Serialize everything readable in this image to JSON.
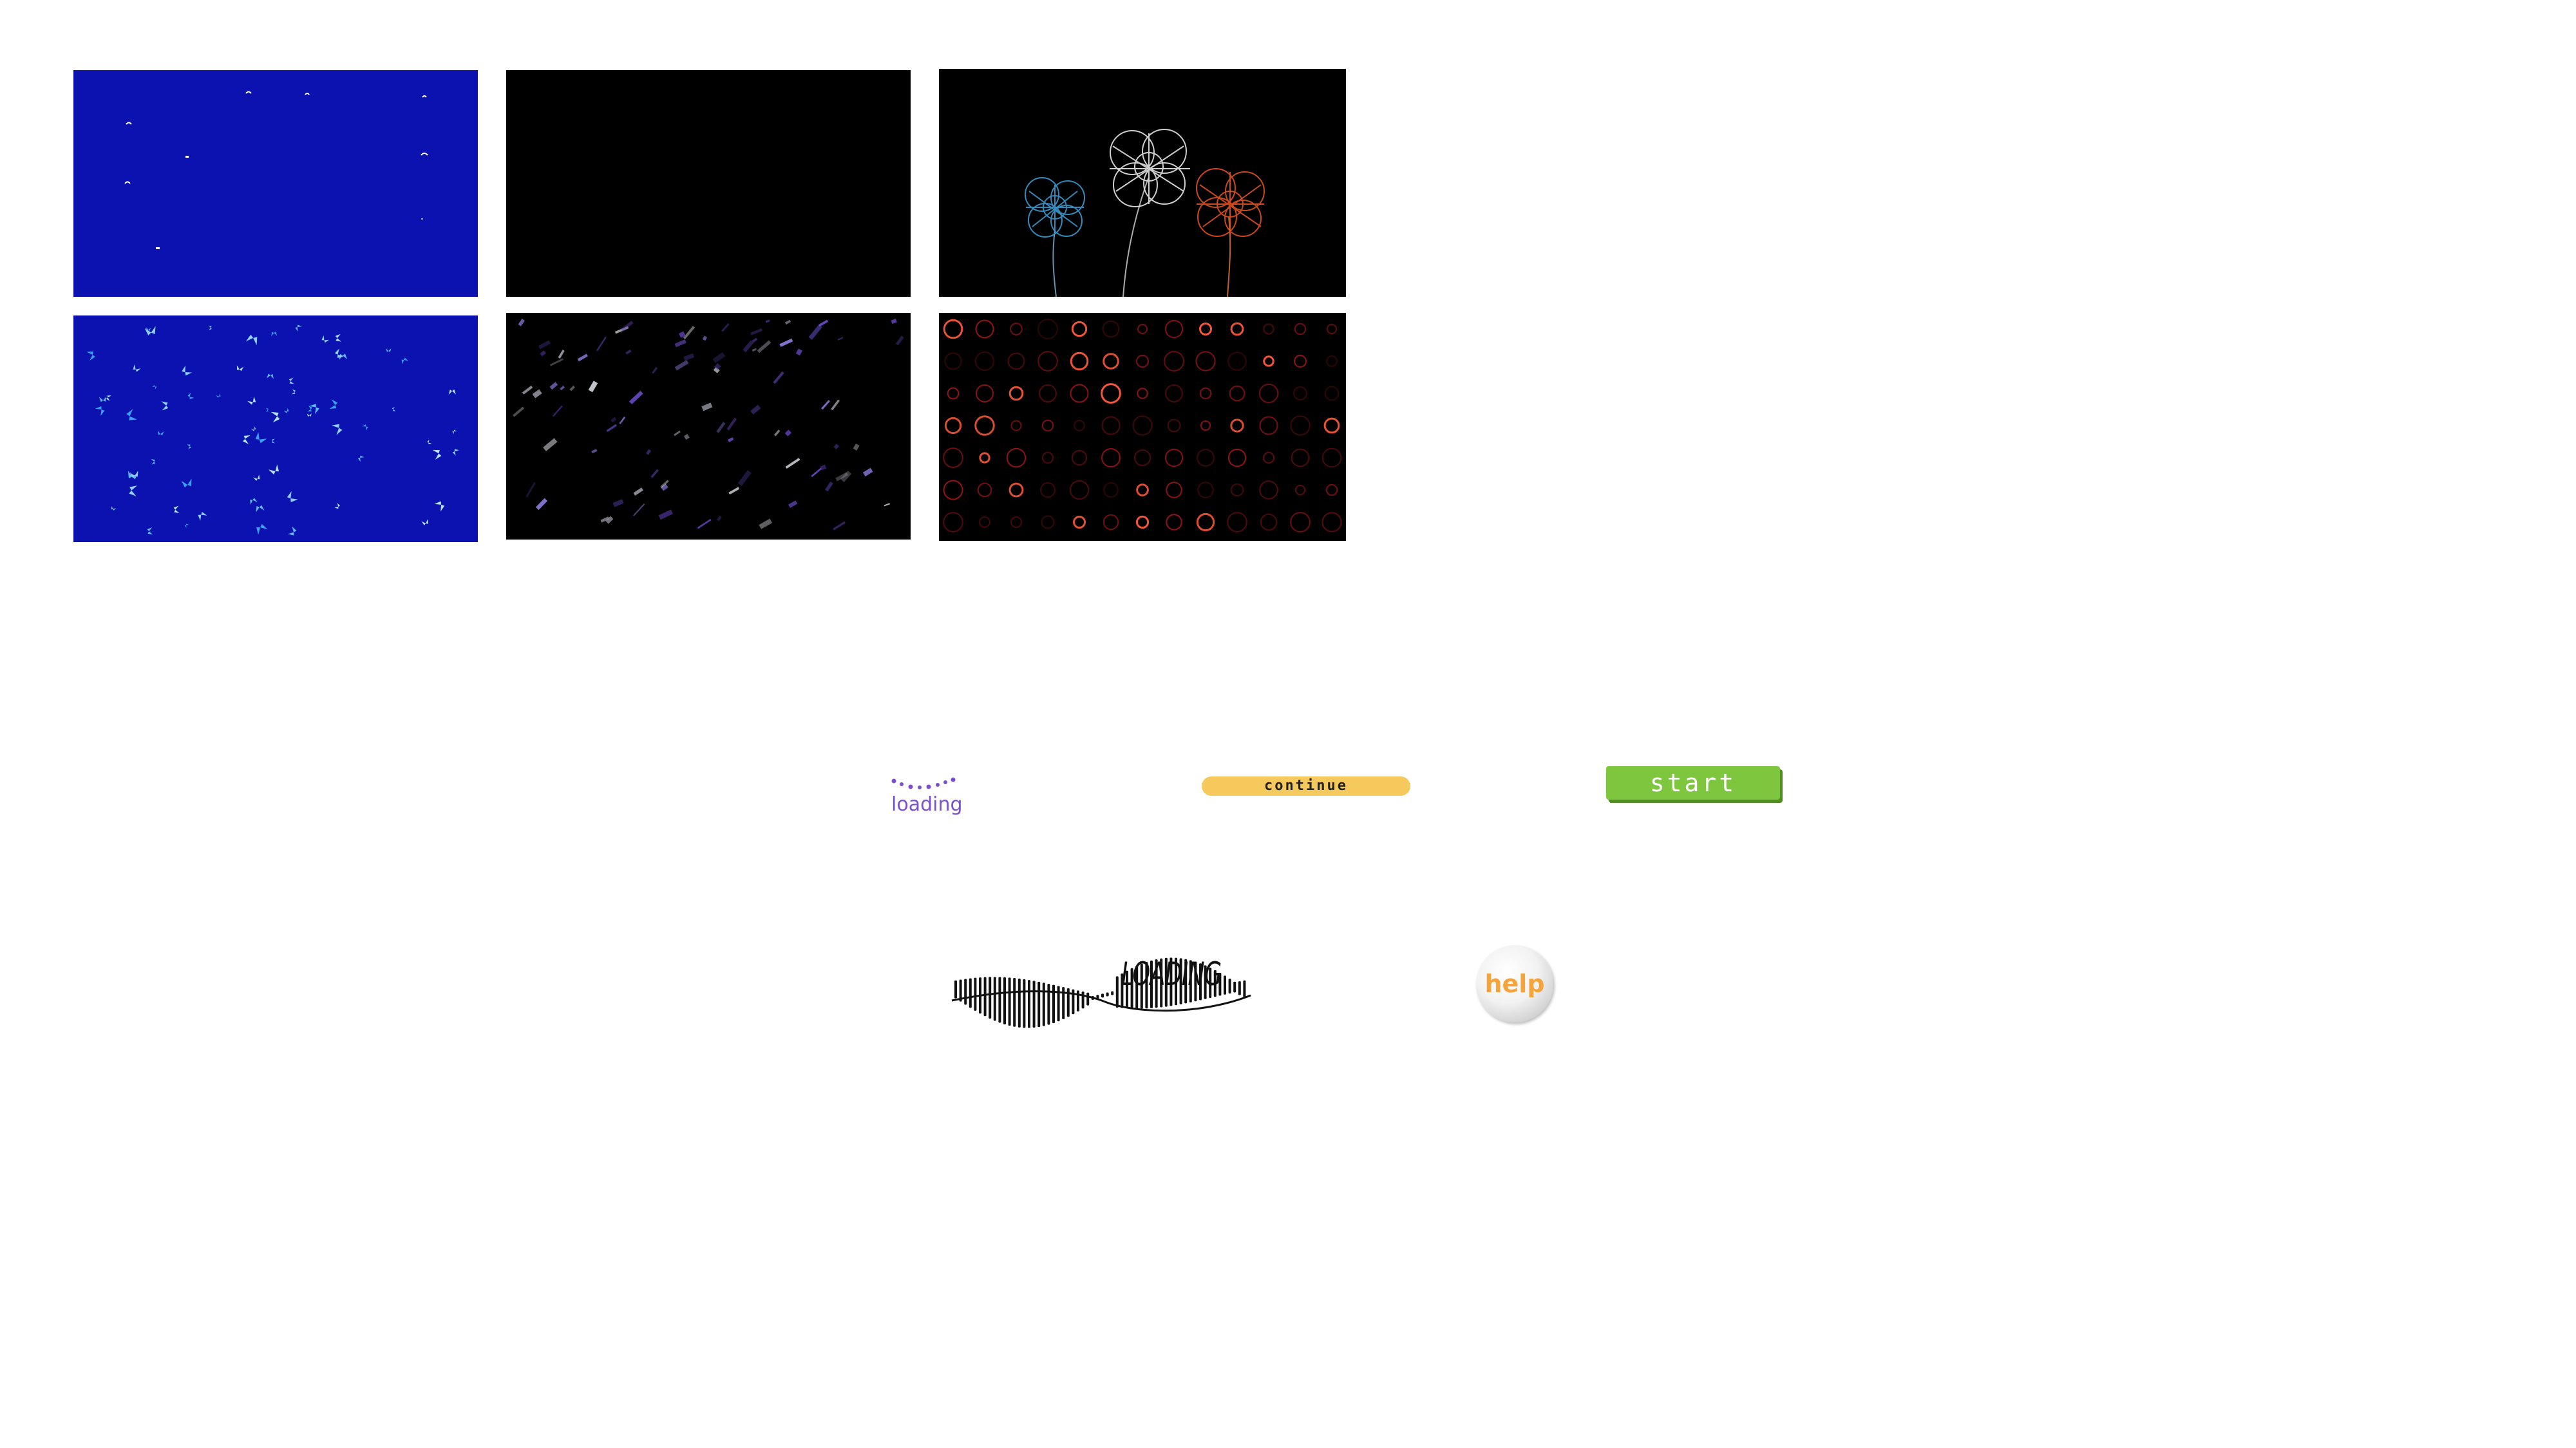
{
  "thumbnails": [
    {
      "name": "snowfall-blue",
      "background": "#0b12b0"
    },
    {
      "name": "black-blank",
      "background": "#000000"
    },
    {
      "name": "neon-flowers",
      "background": "#000000"
    },
    {
      "name": "blue-butterflies",
      "background": "#0b12b0"
    },
    {
      "name": "purple-streaks",
      "background": "#000000"
    },
    {
      "name": "red-rings",
      "background": "#000000"
    }
  ],
  "loading_small": {
    "label": "loading",
    "color": "#7a4fd0"
  },
  "continue_button": {
    "label": "continue",
    "color": "#f5c95b"
  },
  "start_button": {
    "label": "start",
    "color": "#7dc63e"
  },
  "loading_wave": {
    "label": "LOADING"
  },
  "help_button": {
    "label": "help",
    "label_color": "#f4a43a"
  }
}
